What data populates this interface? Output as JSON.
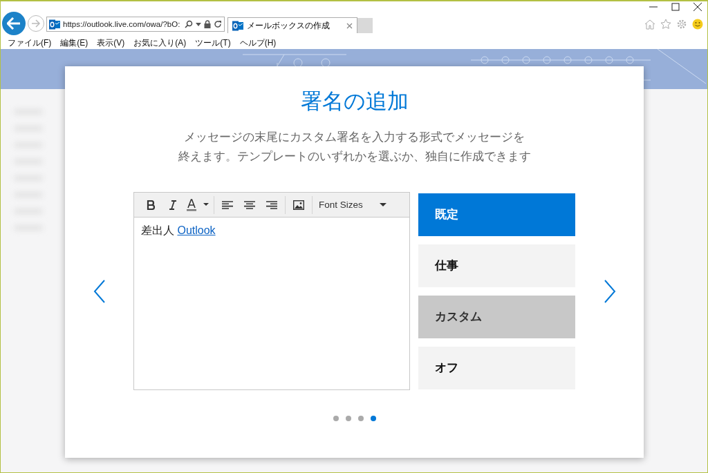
{
  "browser": {
    "address": "https://outlook.live.com/owa/?bO:",
    "tab_title": "メールボックスの作成"
  },
  "menu": [
    "ファイル(F)",
    "編集(E)",
    "表示(V)",
    "お気に入り(A)",
    "ツール(T)",
    "ヘルプ(H)"
  ],
  "dialog": {
    "title": "署名の追加",
    "description": [
      "メッセージの末尾にカスタム署名を入力する形式でメッセージを",
      "終えます。テンプレートのいずれかを選ぶか、独自に作成できます"
    ],
    "editor": {
      "font_sizes": "Font Sizes",
      "body_text": "差出人",
      "body_link": "Outlook"
    },
    "templates": [
      {
        "label": "既定",
        "selected": true,
        "hovered": false
      },
      {
        "label": "仕事",
        "selected": false,
        "hovered": false
      },
      {
        "label": "カスタム",
        "selected": false,
        "hovered": true
      },
      {
        "label": "オフ",
        "selected": false,
        "hovered": false
      }
    ],
    "pages": [
      {
        "selected": false
      },
      {
        "selected": false
      },
      {
        "selected": false
      },
      {
        "selected": true
      }
    ]
  }
}
